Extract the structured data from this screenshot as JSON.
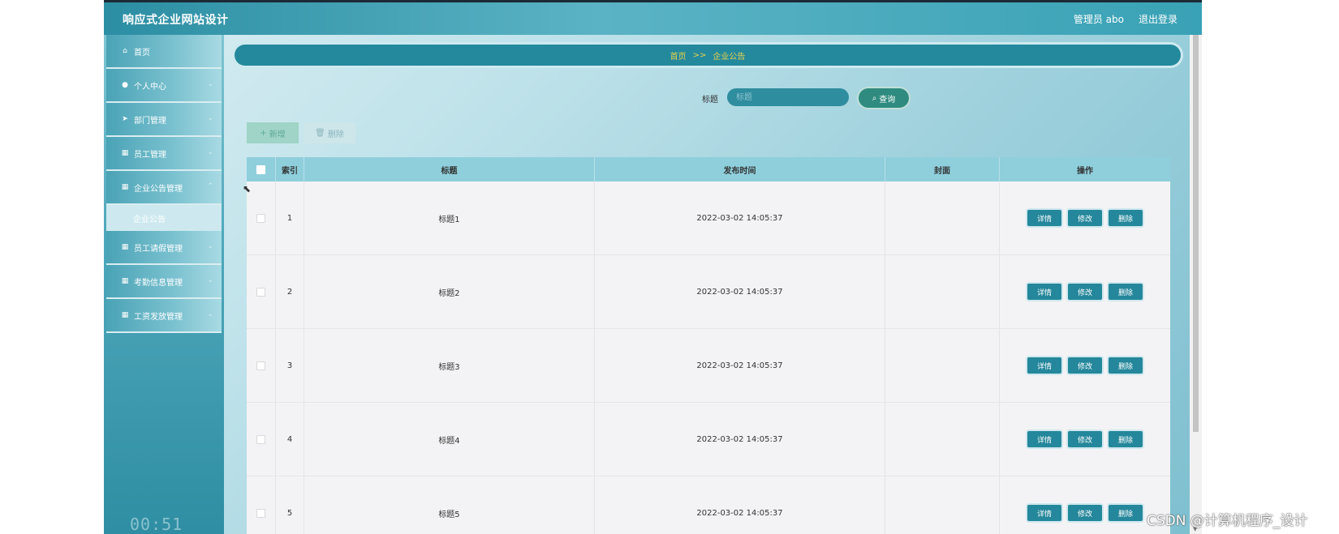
{
  "app": {
    "title": "响应式企业网站设计"
  },
  "header": {
    "user": "管理员 abo",
    "logout": "退出登录"
  },
  "sidebar": {
    "items": [
      {
        "icon": "home-icon",
        "glyph": "⌂",
        "label": "首页"
      },
      {
        "icon": "person-icon",
        "glyph": "●",
        "label": "个人中心"
      },
      {
        "icon": "send-icon",
        "glyph": "➤",
        "label": "部门管理"
      },
      {
        "icon": "grid-icon",
        "glyph": "▦",
        "label": "员工管理"
      },
      {
        "icon": "grid-icon",
        "glyph": "▦",
        "label": "企业公告管理"
      },
      {
        "icon": "grid-icon",
        "glyph": "▦",
        "label": "员工请假管理"
      },
      {
        "icon": "grid-icon",
        "glyph": "▦",
        "label": "考勤信息管理"
      },
      {
        "icon": "grid-icon",
        "glyph": "▦",
        "label": "工资发放管理"
      }
    ],
    "sub_item": "企业公告",
    "timer": "00:51"
  },
  "breadcrumb": {
    "home": "首页",
    "sep": ">>",
    "current": "企业公告"
  },
  "search": {
    "label": "标题",
    "placeholder": "标题",
    "button": "查询"
  },
  "actions": {
    "add": "新增",
    "delete": "删除"
  },
  "table": {
    "headers": [
      "索引",
      "标题",
      "发布时间",
      "封面",
      "操作"
    ],
    "rows": [
      {
        "index": "1",
        "title": "标题1",
        "time": "2022-03-02 14:05:37",
        "cover": ""
      },
      {
        "index": "2",
        "title": "标题2",
        "time": "2022-03-02 14:05:37",
        "cover": ""
      },
      {
        "index": "3",
        "title": "标题3",
        "time": "2022-03-02 14:05:37",
        "cover": ""
      },
      {
        "index": "4",
        "title": "标题4",
        "time": "2022-03-02 14:05:37",
        "cover": ""
      },
      {
        "index": "5",
        "title": "标题5",
        "time": "2022-03-02 14:05:37",
        "cover": ""
      }
    ],
    "row_buttons": {
      "detail": "详情",
      "edit": "修改",
      "delete": "删除"
    }
  },
  "watermark": "CSDN @计算机程序_设计"
}
